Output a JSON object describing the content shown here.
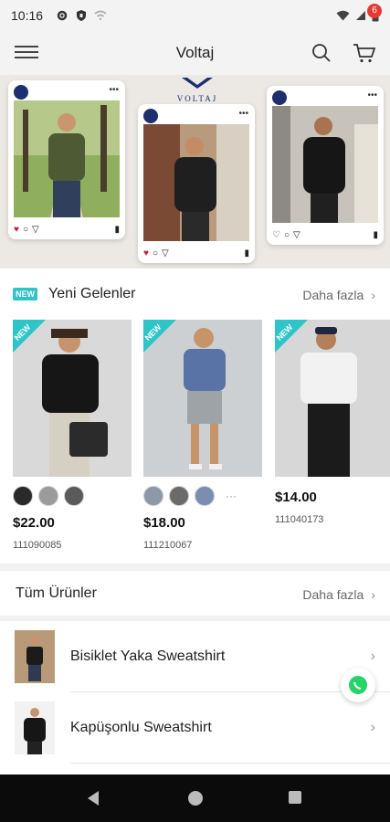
{
  "status_bar": {
    "time": "10:16"
  },
  "app_bar": {
    "title": "Voltaj",
    "cart_count": "6"
  },
  "banner": {
    "logo_text": "VOLTAJ"
  },
  "new_arrivals": {
    "tag": "NEW",
    "title": "Yeni Gelenler",
    "more_label": "Daha fazla",
    "ribbon_label": "NEW",
    "products": [
      {
        "price": "$22.00",
        "sku": "111090085",
        "shirt_color": "#1a1a1a",
        "pants_color": "#d6d0c4"
      },
      {
        "price": "$18.00",
        "sku": "111210067",
        "shirt_color": "#5a73a6",
        "pants_color": "#9ea3a8"
      },
      {
        "price": "$14.00",
        "sku": "111040173",
        "shirt_color": "#f2f2f2",
        "pants_color": "#1b1b1b"
      }
    ],
    "more_swatches": "···"
  },
  "all_products": {
    "title": "Tüm Ürünler",
    "more_label": "Daha fazla",
    "items": [
      {
        "name": "Bisiklet Yaka Sweatshirt"
      },
      {
        "name": "Kapüşonlu Sweatshirt"
      }
    ]
  },
  "colors": {
    "accent": "#2ec4c8",
    "badge": "#e53935",
    "heart": "#c0223b",
    "brand": "#1d2f6f",
    "whatsapp": "#25d366"
  },
  "icons": [
    "menu-icon",
    "search-icon",
    "cart-icon",
    "chevron-right-icon",
    "whatsapp-icon",
    "back-icon",
    "home-icon",
    "recents-icon"
  ]
}
